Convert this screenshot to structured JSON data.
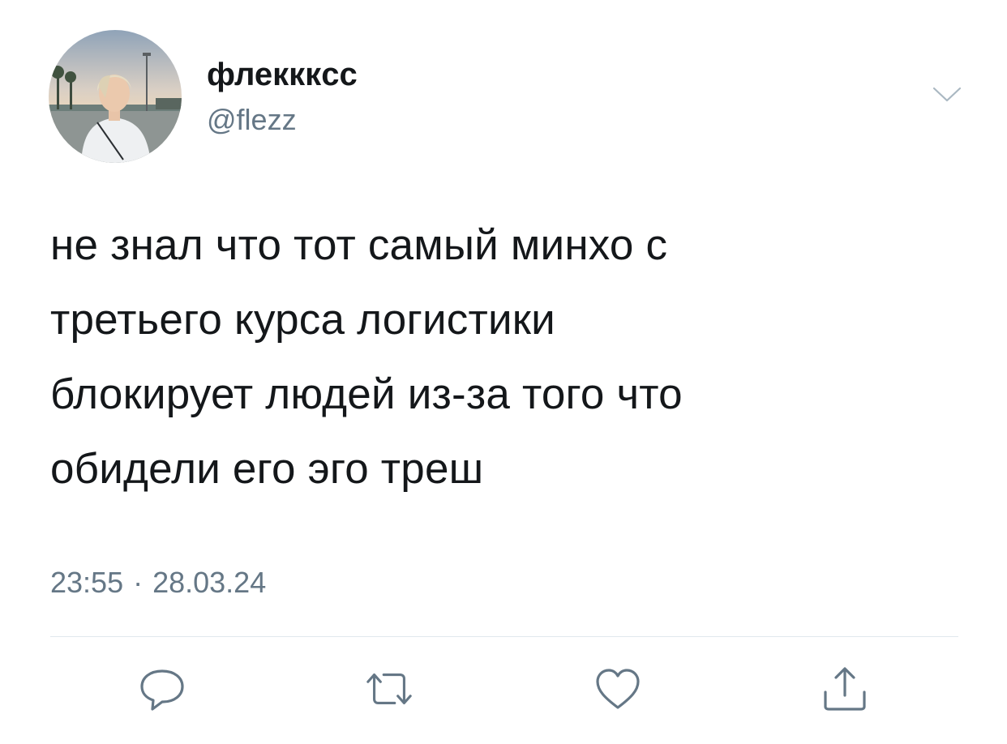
{
  "author": {
    "display_name": "флекккcс",
    "handle": "@flezz"
  },
  "tweet": {
    "lines": [
      "не знал что тот самый минхо с",
      "третьего курса логистики",
      "блокирует людей из-за того что",
      "обидели его эго треш"
    ],
    "time": "23:55",
    "separator": "·",
    "date": "28.03.24"
  },
  "actions": {
    "reply_icon": "reply-icon",
    "retweet_icon": "retweet-icon",
    "like_icon": "heart-icon",
    "share_icon": "share-icon"
  },
  "colors": {
    "text": "#14171a",
    "secondary": "#657786",
    "icon": "#657786",
    "divider": "#e1e8ed"
  }
}
